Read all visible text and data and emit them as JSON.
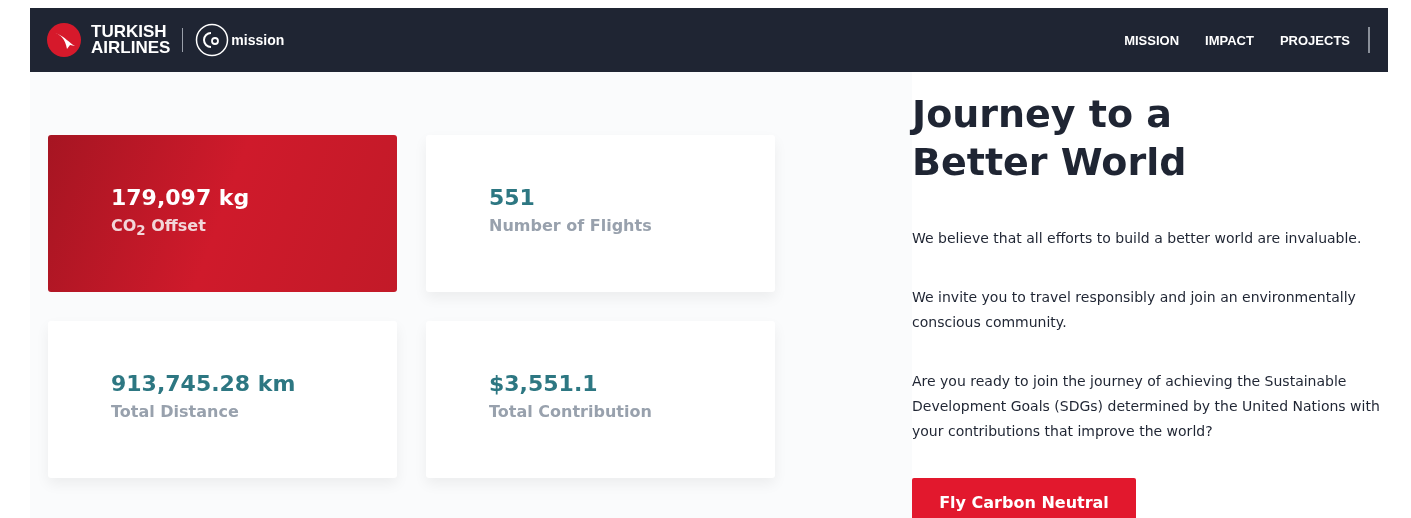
{
  "header": {
    "brand_line_1": "TURKISH",
    "brand_line_2": "AIRLINES",
    "sub_brand": "mission",
    "nav": [
      "MISSION",
      "IMPACT",
      "PROJECTS"
    ]
  },
  "stats": [
    {
      "value": "179,097 kg",
      "label": "CO$_{2}$ Offset",
      "highlighted": true
    },
    {
      "value": "551",
      "label": "Number of Flights",
      "highlighted": false
    },
    {
      "value": "913,745.28 km",
      "label": "Total Distance",
      "highlighted": false
    },
    {
      "value": "$3,551.1",
      "label": "Total Contribution",
      "highlighted": false
    }
  ],
  "intro": {
    "title": "Journey to a Better World",
    "paragraphs": [
      "We believe that all efforts to build a better world are invaluable.",
      "We invite you to travel responsibly and join an environmentally conscious community.",
      "Are you ready to join the journey of achieving the Sustainable Development Goals (SDGs) determined by the United Nations with your contributions that improve the world?"
    ],
    "button": "Fly Carbon Neutral"
  }
}
